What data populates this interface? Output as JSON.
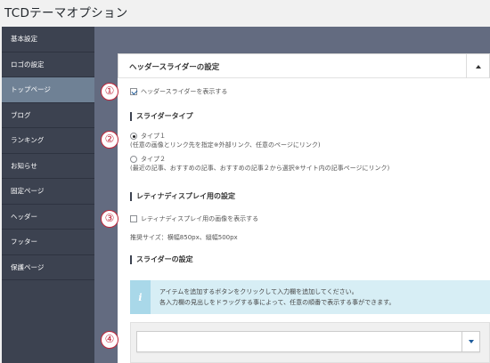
{
  "page": {
    "title": "TCDテーマオプション"
  },
  "sidebar": {
    "items": [
      {
        "label": "基本設定"
      },
      {
        "label": "ロゴの設定"
      },
      {
        "label": "トップページ"
      },
      {
        "label": "ブログ"
      },
      {
        "label": "ランキング"
      },
      {
        "label": "お知らせ"
      },
      {
        "label": "固定ページ"
      },
      {
        "label": "ヘッダー"
      },
      {
        "label": "フッター"
      },
      {
        "label": "保護ページ"
      }
    ],
    "active_index": 2
  },
  "panel": {
    "title": "ヘッダースライダーの設定",
    "show_slider": {
      "label": "ヘッダースライダーを表示する",
      "checked": true
    },
    "slider_type": {
      "heading": "スライダータイプ",
      "type1_label": "タイプ１",
      "type1_desc": "(任意の画像とリンク先を指定※外部リンク、任意のページにリンク)",
      "type2_label": "タイプ２",
      "type2_desc": "(最近の記事、おすすめの記事、おすすめの記事２から選択※サイト内の記事ページにリンク)",
      "selected": "type1"
    },
    "retina": {
      "heading": "レティナディスプレイ用の設定",
      "checkbox_label": "レティナディスプレイ用の画像を表示する",
      "checked": false,
      "size_note": "推奨サイズ：横幅850px、縦幅500px"
    },
    "slider_settings": {
      "heading": "スライダーの設定",
      "info_icon": "i",
      "info_line1": "アイテムを追加するボタンをクリックして入力欄を追加してください。",
      "info_line2": "各入力欄の見出しをドラッグする事によって、任意の順番で表示する事ができます。"
    }
  },
  "markers": [
    "①",
    "②",
    "③",
    "④"
  ],
  "colors": {
    "sidebar_bg": "#3c4250",
    "sidebar_active": "#6f8195",
    "main_bg": "#636b80",
    "marker_red": "#c0263a",
    "info_bg": "#d7eef5",
    "info_icon_bg": "#a9d8e9"
  }
}
